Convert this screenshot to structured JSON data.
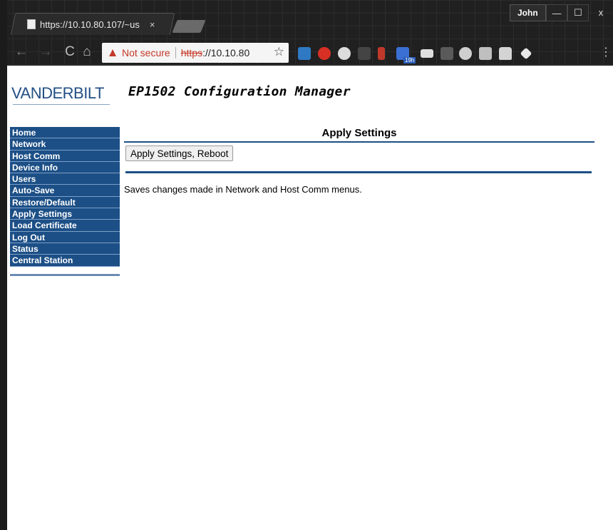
{
  "browser": {
    "tab_title": "https://10.10.80.107/~us",
    "tab_close": "×",
    "user": "John",
    "min_glyph": "—",
    "max_glyph": "☐",
    "close_glyph": "x",
    "not_secure": "Not secure",
    "url_proto": "https",
    "url_host": "://10.10.80",
    "star_glyph": "☆",
    "back_glyph": "←",
    "fwd_glyph": "→",
    "reload_glyph": "C",
    "home_glyph": "⌂",
    "warn_glyph": "▲",
    "menu_glyph": "⋮",
    "extension_badge": "19h"
  },
  "header": {
    "logo": "VANDERBILT",
    "title": "EP1502 Configuration Manager"
  },
  "sidebar": {
    "items": [
      {
        "label": "Home"
      },
      {
        "label": "Network"
      },
      {
        "label": "Host Comm"
      },
      {
        "label": "Device Info"
      },
      {
        "label": "Users"
      },
      {
        "label": "Auto-Save"
      },
      {
        "label": "Restore/Default"
      },
      {
        "label": "Apply Settings"
      },
      {
        "label": "Load Certificate"
      },
      {
        "label": "Log Out"
      },
      {
        "label": "Status"
      },
      {
        "label": "Central Station"
      }
    ]
  },
  "main": {
    "title": "Apply Settings",
    "button_label": "Apply Settings, Reboot",
    "description": "Saves changes made in Network and Host Comm menus."
  }
}
